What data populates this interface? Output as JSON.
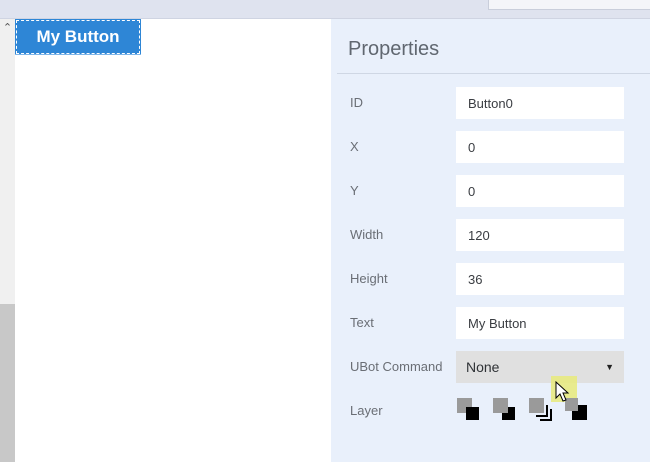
{
  "properties": {
    "title": "Properties",
    "fields": [
      {
        "label": "ID",
        "value": "Button0"
      },
      {
        "label": "X",
        "value": "0"
      },
      {
        "label": "Y",
        "value": "0"
      },
      {
        "label": "Width",
        "value": "120"
      },
      {
        "label": "Height",
        "value": "36"
      },
      {
        "label": "Text",
        "value": "My Button"
      }
    ],
    "command": {
      "label": "UBot Command",
      "value": "None"
    },
    "layer": {
      "label": "Layer"
    }
  },
  "canvas": {
    "button_text": "My Button"
  },
  "icons": [
    "chevron-up-icon",
    "caret-down-icon",
    "bring-to-front-icon",
    "bring-forward-icon",
    "send-backward-icon",
    "send-to-back-icon",
    "mouse-pointer-icon"
  ],
  "colors": {
    "button_blue": "#2e86d6",
    "panel_background": "#e9f0fb",
    "topbar": "#dfe3ef"
  }
}
